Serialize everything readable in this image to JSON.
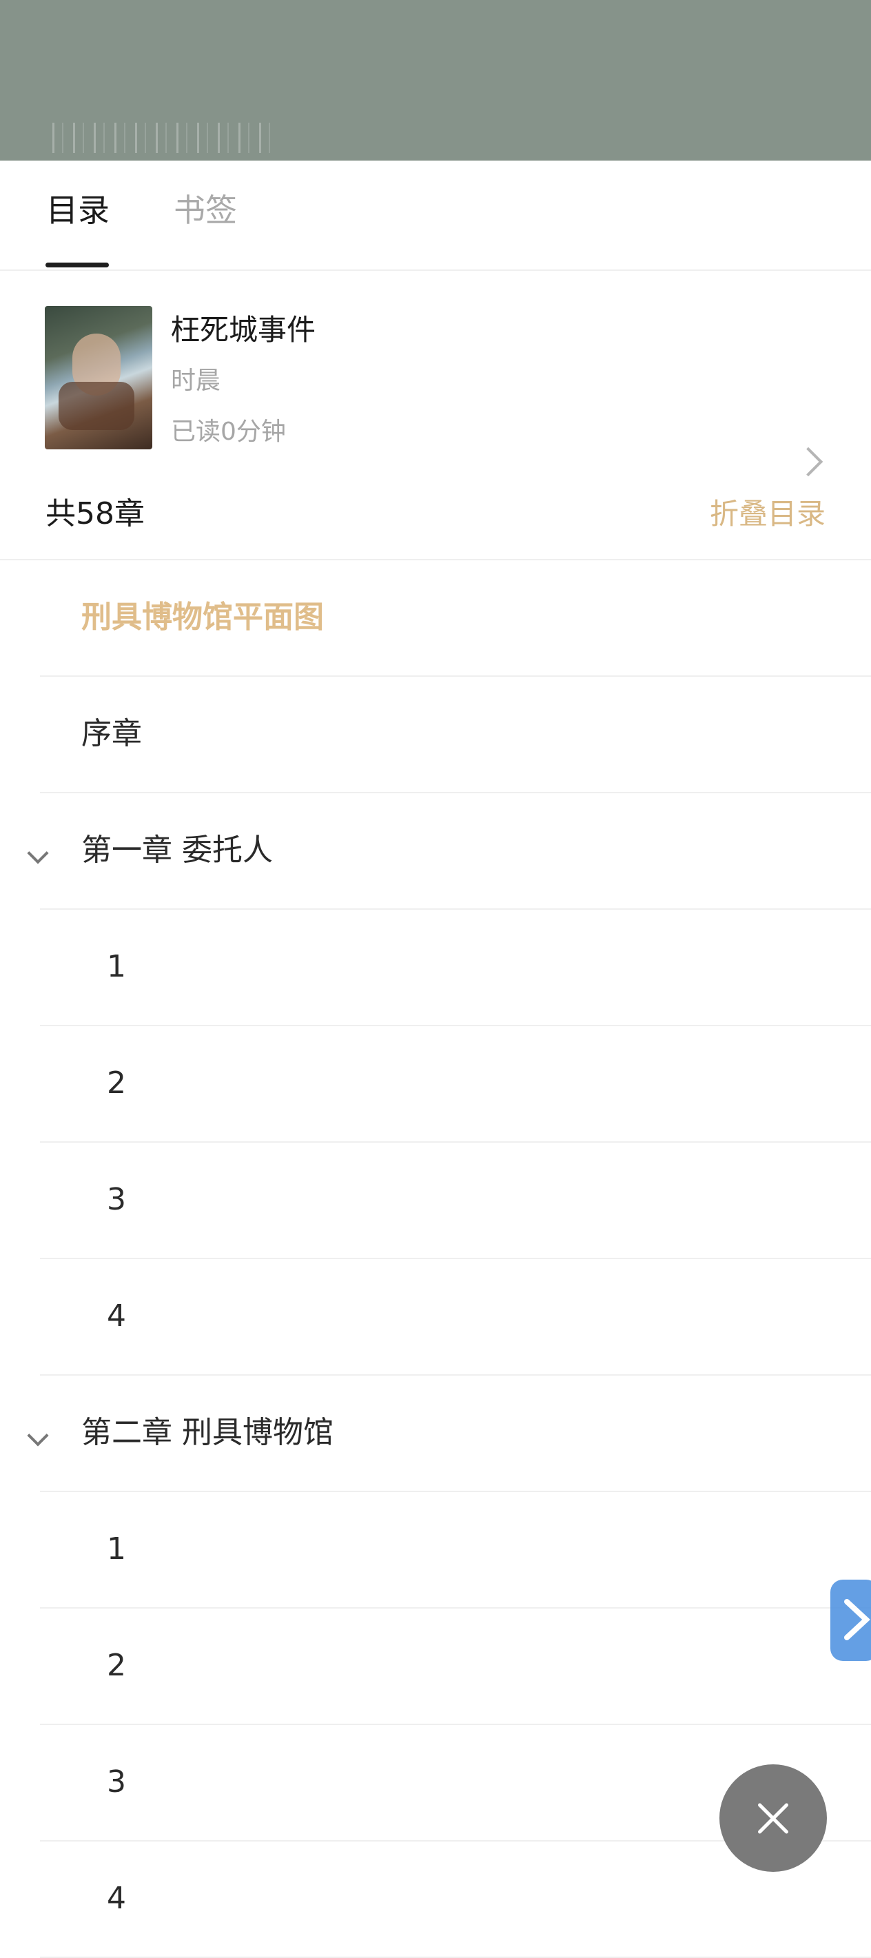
{
  "tabs": {
    "toc": "目录",
    "bookmarks": "书签"
  },
  "book": {
    "title": "枉死城事件",
    "author": "时晨",
    "read_time": "已读0分钟"
  },
  "toc": {
    "count_label": "共58章",
    "fold_label": "折叠目录",
    "items": [
      {
        "label": "刑具博物馆平面图"
      },
      {
        "label": "序章"
      },
      {
        "label": "第一章 委托人"
      },
      {
        "label": "1"
      },
      {
        "label": "2"
      },
      {
        "label": "3"
      },
      {
        "label": "4"
      },
      {
        "label": "第二章 刑具博物馆"
      },
      {
        "label": "1"
      },
      {
        "label": "2"
      },
      {
        "label": "3"
      },
      {
        "label": "4"
      }
    ]
  },
  "icons": {
    "chevron": "chevron-right-icon",
    "toggle": "chevron-down-icon",
    "close": "close-icon"
  },
  "colors": {
    "accent": "#d9b885",
    "active_item": "#e0bd8a",
    "header_bg": "#86938a",
    "close_bg": "#7a7a7a",
    "float_tab": "#4a8fe0"
  }
}
